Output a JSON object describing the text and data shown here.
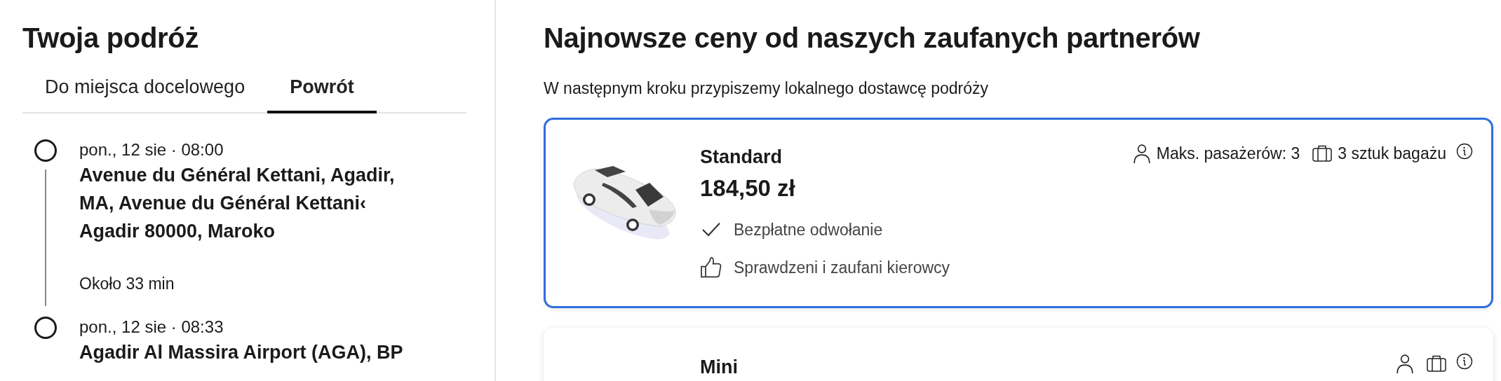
{
  "trip": {
    "title": "Twoja podróż",
    "tabs": [
      {
        "label": "Do miejsca docelowego",
        "selected": false
      },
      {
        "label": "Powrót",
        "selected": true
      }
    ],
    "stops": [
      {
        "time": "pon., 12 sie · 08:00",
        "address": "Avenue du Général Kettani, Agadir, MA, Avenue du Général Kettani‹ Agadir 80000, Maroko",
        "duration": "Około 33 min"
      },
      {
        "time": "pon., 12 sie · 08:33",
        "address": "Agadir Al Massira Airport (AGA), BP"
      }
    ]
  },
  "offers": {
    "title": "Najnowsze ceny od naszych zaufanych partnerów",
    "subtitle": "W następnym kroku przypiszemy lokalnego dostawcę podróży",
    "cards": [
      {
        "name": "Standard",
        "price": "184,50 zł",
        "passengers": "Maks. pasażerów: 3",
        "luggage": "3 sztuk bagażu",
        "selected": true,
        "features": [
          {
            "kind": "check",
            "text": "Bezpłatne odwołanie"
          },
          {
            "kind": "thumb",
            "text": "Sprawdzeni i zaufani kierowcy"
          }
        ]
      },
      {
        "name": "Mini",
        "selected": false
      }
    ]
  }
}
